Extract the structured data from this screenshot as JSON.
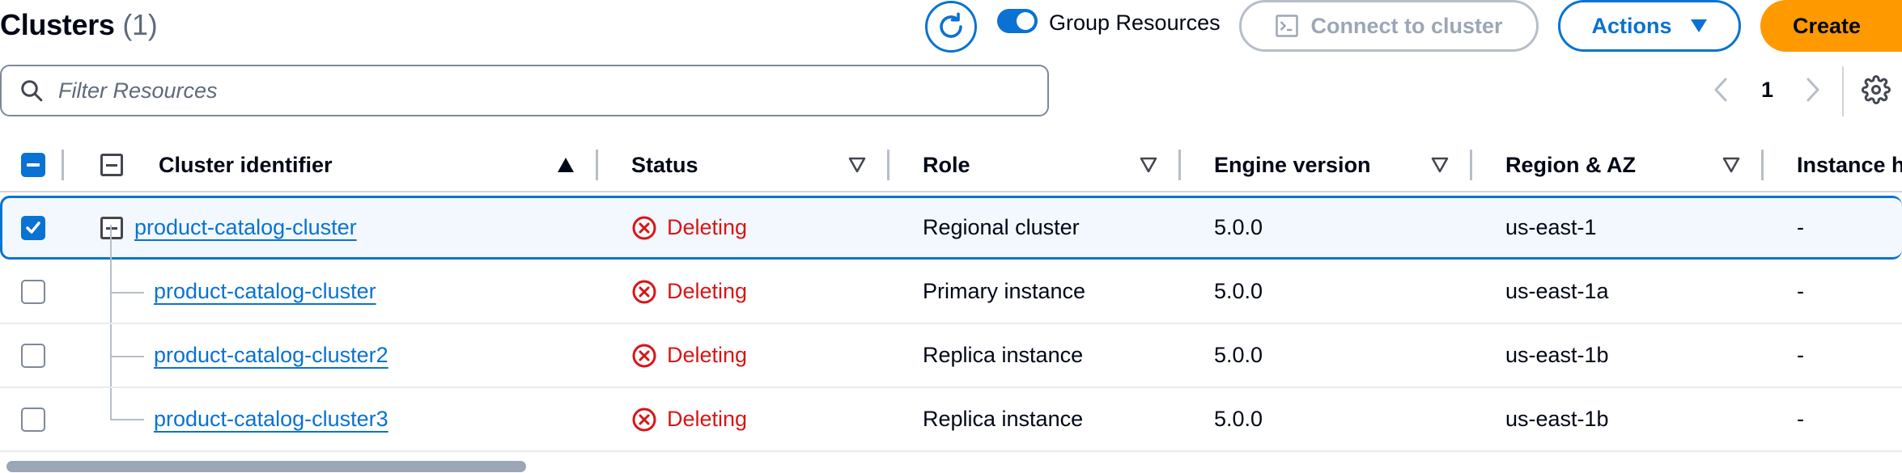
{
  "header": {
    "title": "Clusters",
    "count": "(1)",
    "group_resources_label": "Group Resources",
    "connect_label": "Connect to cluster",
    "actions_label": "Actions",
    "create_label": "Create"
  },
  "search": {
    "placeholder": "Filter Resources"
  },
  "pagination": {
    "current_page": "1"
  },
  "columns": [
    {
      "label": "Cluster identifier",
      "sort": "ascending"
    },
    {
      "label": "Status",
      "sort": "none"
    },
    {
      "label": "Role",
      "sort": "none"
    },
    {
      "label": "Engine version",
      "sort": "none"
    },
    {
      "label": "Region & AZ",
      "sort": "none"
    },
    {
      "label": "Instance h",
      "sort": "none"
    }
  ],
  "rows": [
    {
      "identifier": "product-catalog-cluster",
      "status": "Deleting",
      "role": "Regional cluster",
      "engine": "5.0.0",
      "region": "us-east-1",
      "instance": "-",
      "selected": true,
      "parent": true
    },
    {
      "identifier": "product-catalog-cluster",
      "status": "Deleting",
      "role": "Primary instance",
      "engine": "5.0.0",
      "region": "us-east-1a",
      "instance": "-",
      "selected": false,
      "parent": false
    },
    {
      "identifier": "product-catalog-cluster2",
      "status": "Deleting",
      "role": "Replica instance",
      "engine": "5.0.0",
      "region": "us-east-1b",
      "instance": "-",
      "selected": false,
      "parent": false
    },
    {
      "identifier": "product-catalog-cluster3",
      "status": "Deleting",
      "role": "Replica instance",
      "engine": "5.0.0",
      "region": "us-east-1b",
      "instance": "-",
      "selected": false,
      "parent": false
    }
  ],
  "colors": {
    "accent": "#0972d3",
    "primary_button": "#ff9900",
    "status_error": "#d91515",
    "disabled": "#9ba7b6"
  },
  "icons": {
    "refresh": "refresh-icon",
    "terminal": "terminal-icon",
    "caret_down": "caret-down-icon",
    "search": "search-icon",
    "settings": "gear-icon",
    "status_deleting": "error-circle-icon"
  }
}
